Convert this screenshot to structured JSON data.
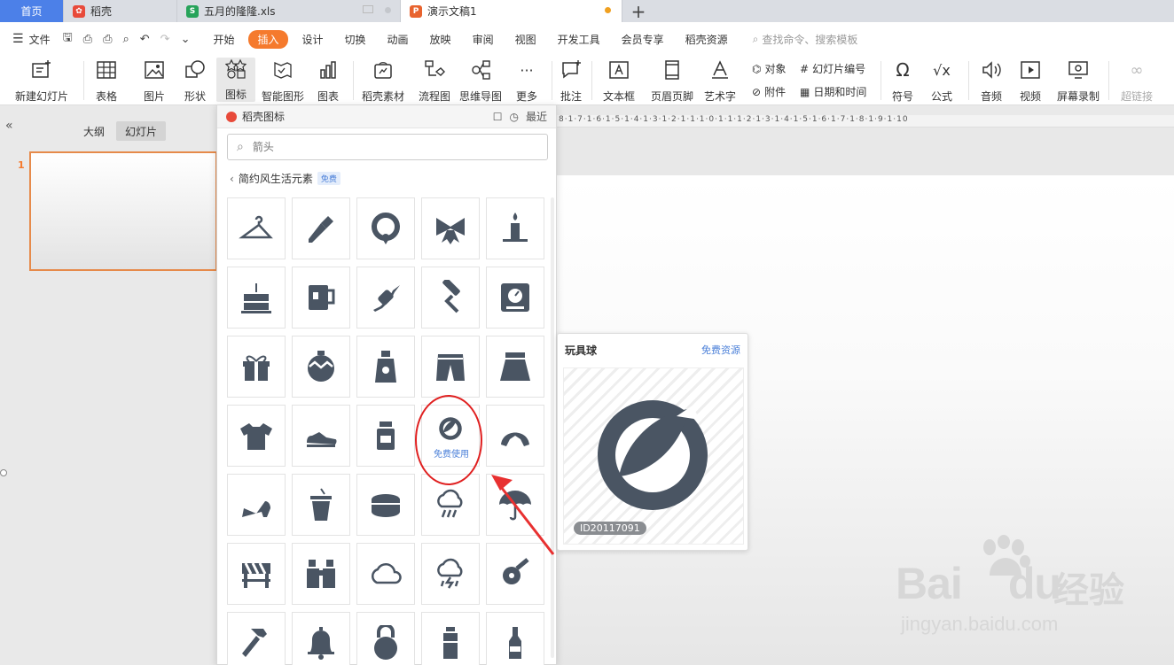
{
  "tabs": [
    {
      "label": "首页",
      "icon": "home-tab"
    },
    {
      "label": "稻壳",
      "icon": "docer-logo-icon"
    },
    {
      "label": "五月的隆隆.xls",
      "icon": "spreadsheet-icon"
    },
    {
      "label": "演示文稿1",
      "icon": "presentation-icon"
    }
  ],
  "menu": {
    "file_label": "文件",
    "tabs": [
      "开始",
      "插入",
      "设计",
      "切换",
      "动画",
      "放映",
      "审阅",
      "视图",
      "开发工具",
      "会员专享",
      "稻壳资源"
    ],
    "active_tab": "插入",
    "search_placeholder": "查找命令、搜索模板"
  },
  "ribbon": {
    "new_slide": "新建幻灯片",
    "table": "表格",
    "picture": "图片",
    "shape": "形状",
    "icon": "图标",
    "smart_graphic": "智能图形",
    "chart": "图表",
    "docer_material": "稻壳素材",
    "flowchart": "流程图",
    "mindmap": "思维导图",
    "more": "更多",
    "comment": "批注",
    "textbox": "文本框",
    "header_footer": "页眉页脚",
    "art_text": "艺术字",
    "object": "对象",
    "slide_number": "幻灯片编号",
    "attachment": "附件",
    "date_time": "日期和时间",
    "symbol": "符号",
    "formula": "公式",
    "audio": "音频",
    "video": "视频",
    "screen_record": "屏幕录制",
    "hyperlink": "超链接"
  },
  "left_panel": {
    "outline": "大纲",
    "slides": "幻灯片",
    "slide_number": "1"
  },
  "ruler_text": "8·1·7·1·6·1·5·1·4·1·3·1·2·1·1·1·0·1·1·1·2·1·3·1·4·1·5·1·6·1·7·1·8·1·9·1·10",
  "icon_panel": {
    "title": "稻壳图标",
    "recent": "最近",
    "search_placeholder": "箭头",
    "category": "简约风生活元素",
    "category_badge": "免费",
    "hover_label": "免费使用",
    "icons": [
      "hanger-icon",
      "screwdriver-icon",
      "wreath-icon",
      "bow-icon",
      "candle-icon",
      "cake-icon",
      "mug-icon",
      "candy-icon",
      "paint-roller-icon",
      "scale-icon",
      "gift-icon",
      "ornament-icon",
      "sunscreen-icon",
      "shorts-icon",
      "skirt-icon",
      "tshirt-icon",
      "shoe-icon",
      "jar-icon",
      "ball-icon",
      "croissant-icon",
      "high-heel-icon",
      "drink-cup-icon",
      "tin-can-icon",
      "rain-cloud-icon",
      "umbrella-icon",
      "barrier-icon",
      "binoculars-icon",
      "cloud-icon",
      "storm-cloud-icon",
      "tape-measure-icon",
      "hammer-icon",
      "bell-icon",
      "kettlebell-icon",
      "bottle-icon",
      "beer-bottle-icon"
    ]
  },
  "preview": {
    "title": "玩具球",
    "link": "免费资源",
    "id": "ID20117091"
  },
  "watermark": {
    "brand": "Bai",
    "brand2": "du",
    "jingyan": "经验",
    "url": "jingyan.baidu.com"
  },
  "colors": {
    "accent": "#f57a2d",
    "home_tab": "#4c80e8",
    "icon_fill": "#4a5563",
    "link": "#4a7fd8",
    "highlight_ring": "#e02020"
  }
}
